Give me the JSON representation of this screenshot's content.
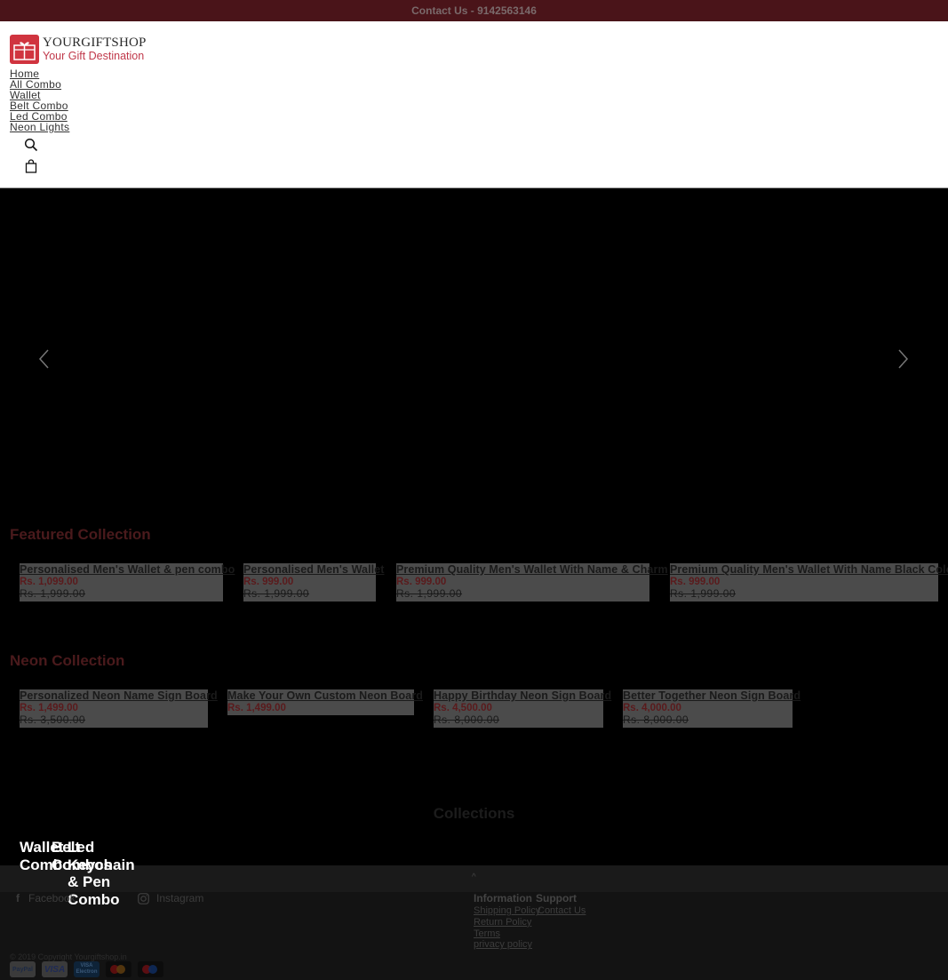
{
  "topbar": {
    "contact": "Contact Us - 9142563146"
  },
  "brand": {
    "name": "YOURGIFTSHOP",
    "tagline": "Your Gift Destination",
    "accent": "#d0343f"
  },
  "nav": {
    "items": [
      {
        "label": "Home"
      },
      {
        "label": "All Combo"
      },
      {
        "label": "Wallet"
      },
      {
        "label": "Belt Combo"
      },
      {
        "label": "Led Combo"
      },
      {
        "label": "Neon Lights"
      }
    ],
    "icons": [
      "search-icon",
      "bag-icon"
    ]
  },
  "hero": {
    "prev_icon": "chevron-left-icon",
    "next_icon": "chevron-right-icon"
  },
  "featured": {
    "title": "Featured Collection",
    "products": [
      {
        "name": "Personalised Men's Wallet & pen combo",
        "price": "Rs. 1,099.00",
        "compare": "Rs. 1,999.00"
      },
      {
        "name": "Personalised Men's Wallet",
        "price": "Rs. 999.00",
        "compare": "Rs. 1,999.00"
      },
      {
        "name": "Premium Quality Men's Wallet With Name & Charm",
        "price": "Rs. 999.00",
        "compare": "Rs. 1,999.00"
      },
      {
        "name": "Premium Quality Men's Wallet With Name Black Color",
        "price": "Rs. 999.00",
        "compare": "Rs. 1,999.00"
      }
    ]
  },
  "neon": {
    "title": "Neon Collection",
    "products": [
      {
        "name": "Personalized Neon Name Sign Board",
        "price": "Rs. 1,499.00",
        "compare": "Rs. 3,500.00"
      },
      {
        "name": "Make Your Own Custom Neon Board",
        "price": "Rs. 1,499.00",
        "compare": ""
      },
      {
        "name": "Happy Birthday Neon Sign Board",
        "price": "Rs. 4,500.00",
        "compare": "Rs. 8,000.00"
      },
      {
        "name": "Better Together Neon Sign Board",
        "price": "Rs. 4,000.00",
        "compare": "Rs. 8,000.00"
      }
    ]
  },
  "collections": {
    "title": "Collections",
    "items": [
      {
        "label": "Wallet Combo"
      },
      {
        "label": "Belt Combos"
      },
      {
        "label": "Led Keychain & Pen Combo"
      }
    ]
  },
  "footer": {
    "social": [
      {
        "label": "Facebook",
        "icon": "facebook-icon"
      },
      {
        "label": "Instagram",
        "icon": "instagram-icon"
      }
    ],
    "caret": "^",
    "information": {
      "heading": "Information",
      "links": [
        "Shipping Policy",
        "Return Policy",
        "Terms",
        "privacy policy"
      ]
    },
    "support": {
      "heading": "Support",
      "links": [
        "Contact Us"
      ]
    },
    "copyright": "© 2019 Copyright Yourgiftshop.in",
    "payments": [
      {
        "label": "PayPal"
      },
      {
        "label": "VISA"
      },
      {
        "label": "VISA Electron"
      },
      {
        "label": "Mastercard"
      },
      {
        "label": "Maestro"
      }
    ]
  }
}
